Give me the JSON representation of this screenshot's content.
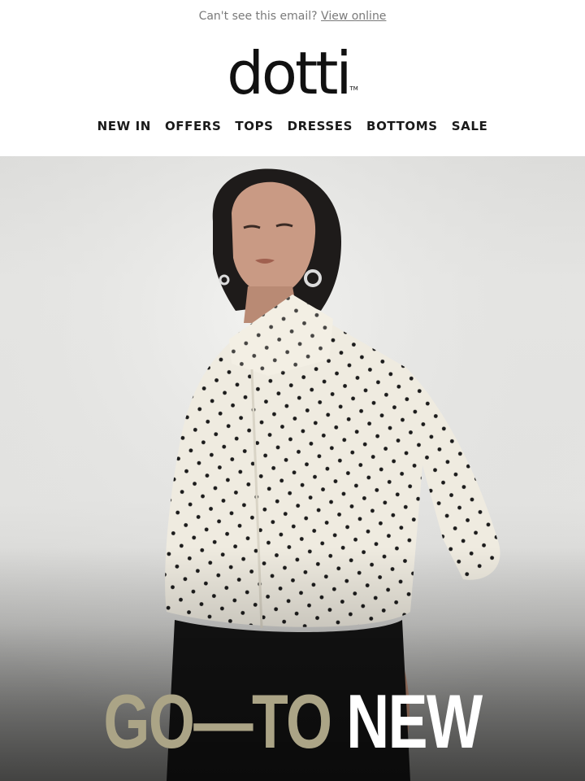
{
  "preheader": {
    "text": "Can't see this email?",
    "link_label": "View online"
  },
  "brand": {
    "logo_text": "dotti",
    "trademark": "TM"
  },
  "nav": {
    "items": [
      {
        "label": "NEW IN"
      },
      {
        "label": "OFFERS"
      },
      {
        "label": "TOPS"
      },
      {
        "label": "DRESSES"
      },
      {
        "label": "BOTTOMS"
      },
      {
        "label": "SALE"
      }
    ]
  },
  "hero": {
    "headline_part1": "GO—TO",
    "headline_part2": "NEW"
  },
  "colors": {
    "accent_khaki": "#aba486",
    "text_dark": "#1a1a1a",
    "muted": "#7a7a7a"
  }
}
